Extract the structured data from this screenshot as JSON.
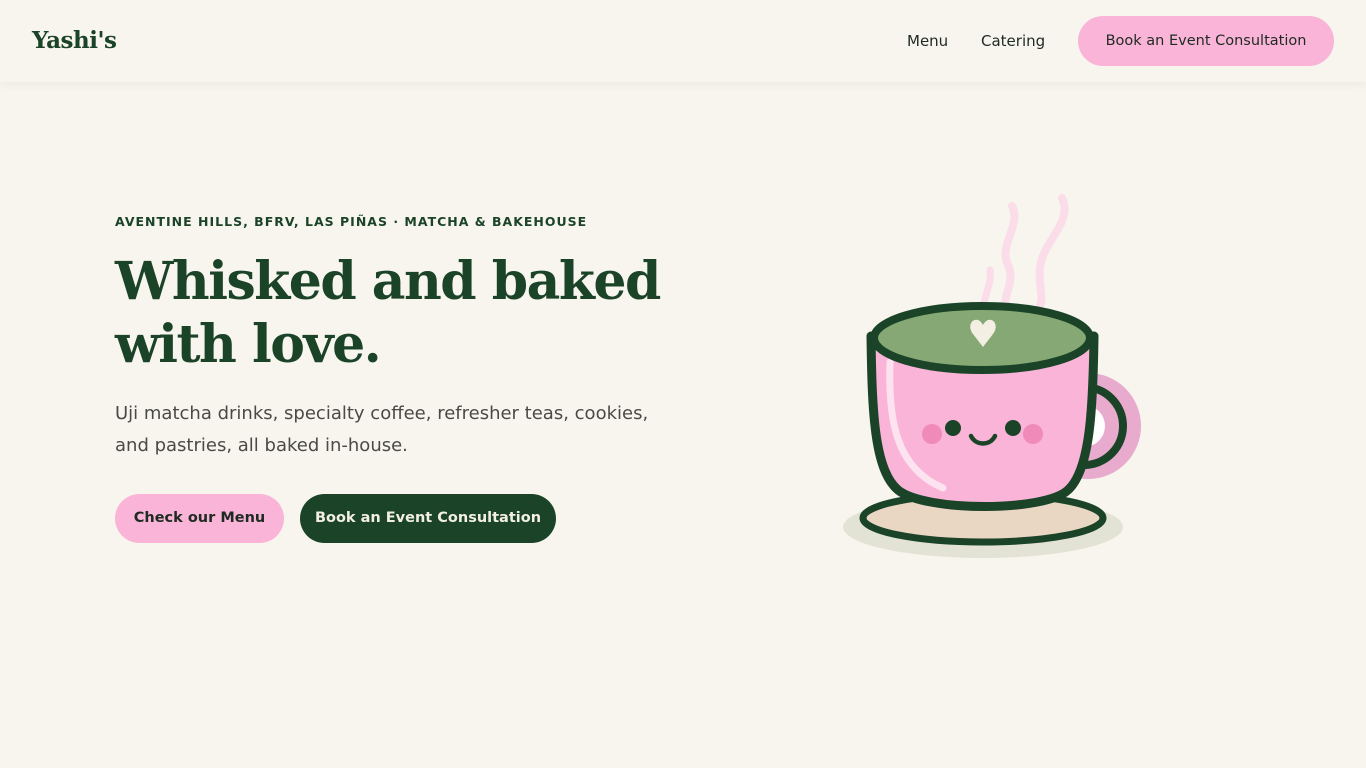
{
  "header": {
    "brand": "Yashi's",
    "nav": {
      "menu_label": "Menu",
      "catering_label": "Catering",
      "cta_label": "Book an Event Consultation"
    }
  },
  "hero": {
    "eyebrow": "AVENTINE HILLS, BFRV, LAS PIÑAS · MATCHA & BAKEHOUSE",
    "headline_line1": "Whisked and baked",
    "headline_line2": "with love.",
    "description": "Uji matcha drinks, specialty coffee, refresher teas, cookies, and pastries, all baked in-house.",
    "primary_button": "Check our Menu",
    "secondary_button": "Book an Event Consultation",
    "illustration": "smiling-matcha-cup-icon"
  },
  "colors": {
    "background": "#f8f5ee",
    "brand_green": "#1b4328",
    "accent_pink": "#f9b4d8",
    "matcha": "#86a874",
    "saucer": "#e9d7c4"
  }
}
